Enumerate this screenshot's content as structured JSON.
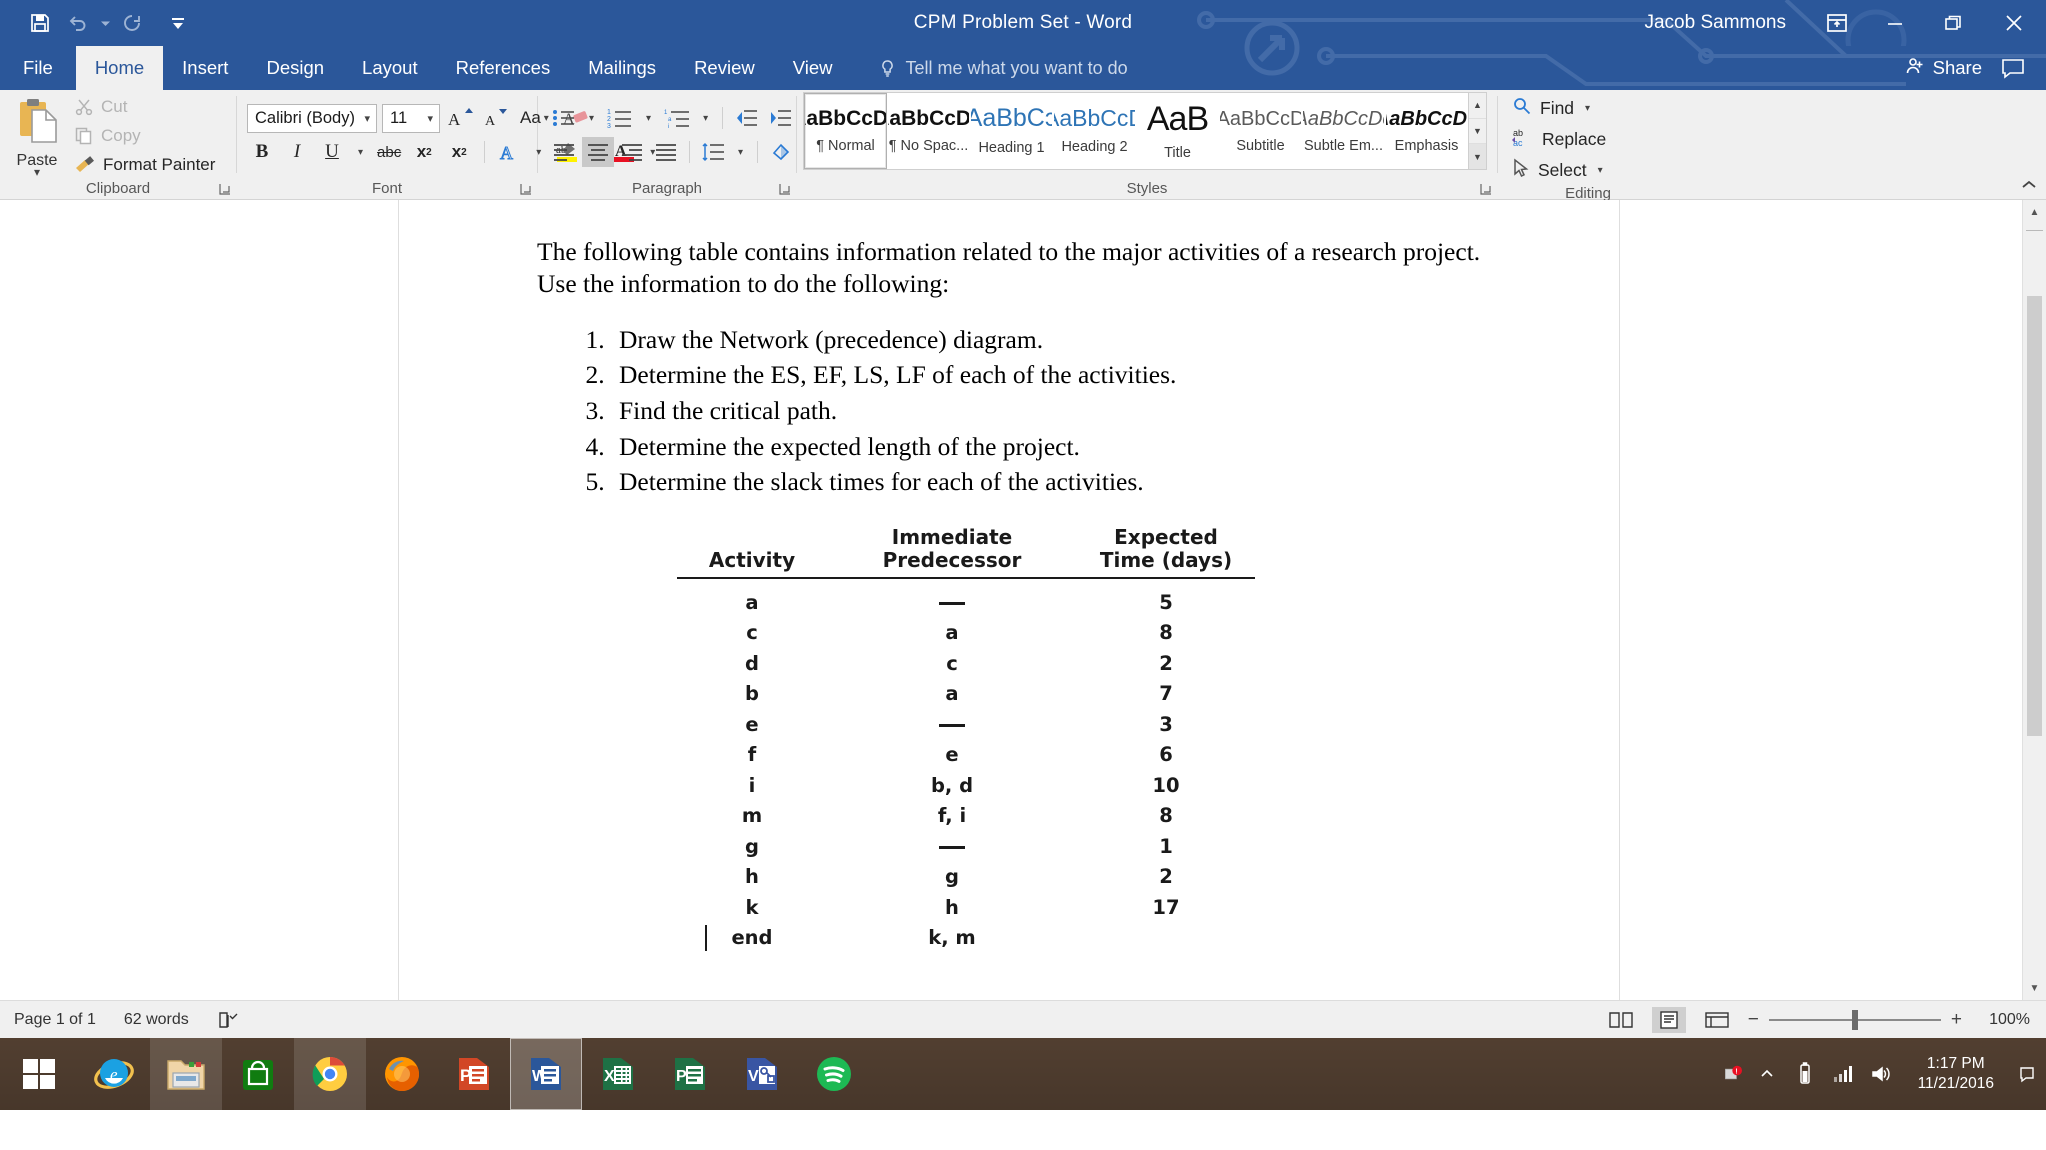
{
  "titlebar": {
    "document_title": "CPM Problem Set  -  Word",
    "user_name": "Jacob Sammons",
    "quick_access": [
      {
        "name": "save-icon",
        "label": "Save"
      },
      {
        "name": "undo-icon",
        "label": "Undo"
      },
      {
        "name": "redo-icon",
        "label": "Repeat"
      },
      {
        "name": "customize-quick-access-icon",
        "label": "Customize Quick Access Toolbar"
      }
    ],
    "window_controls": [
      {
        "name": "ribbon-display-options-icon",
        "label": "Ribbon Display Options"
      },
      {
        "name": "minimize-icon",
        "label": "Minimize"
      },
      {
        "name": "restore-icon",
        "label": "Restore Down"
      },
      {
        "name": "close-icon",
        "label": "Close"
      }
    ]
  },
  "tabs": [
    {
      "label": "File",
      "active": false
    },
    {
      "label": "Home",
      "active": true
    },
    {
      "label": "Insert",
      "active": false
    },
    {
      "label": "Design",
      "active": false
    },
    {
      "label": "Layout",
      "active": false
    },
    {
      "label": "References",
      "active": false
    },
    {
      "label": "Mailings",
      "active": false
    },
    {
      "label": "Review",
      "active": false
    },
    {
      "label": "View",
      "active": false
    }
  ],
  "tellme": {
    "text": "Tell me what you want to do"
  },
  "share": {
    "label": "Share"
  },
  "ribbon": {
    "clipboard": {
      "group_label": "Clipboard",
      "paste_label": "Paste",
      "cut_label": "Cut",
      "copy_label": "Copy",
      "format_painter_label": "Format Painter"
    },
    "font": {
      "group_label": "Font",
      "font_name": "Calibri (Body)",
      "font_size": "11",
      "bold_label": "B",
      "italic_label": "I",
      "underline_label": "U",
      "strikethrough_label": "abc",
      "subscript_label": "x",
      "superscript_label": "x",
      "change_case_label": "Aa"
    },
    "paragraph": {
      "group_label": "Paragraph"
    },
    "styles": {
      "group_label": "Styles",
      "items": [
        {
          "preview": "AaBbCcDc",
          "name": "¶ Normal",
          "cls": "sp-normal",
          "selected": true
        },
        {
          "preview": "AaBbCcDc",
          "name": "¶ No Spac...",
          "cls": "sp-normal",
          "selected": false
        },
        {
          "preview": "AaBbCɔ",
          "name": "Heading 1",
          "cls": "sp-h1",
          "selected": false
        },
        {
          "preview": "AaBbCcD",
          "name": "Heading 2",
          "cls": "sp-h2",
          "selected": false
        },
        {
          "preview": "AaB",
          "name": "Title",
          "cls": "sp-title",
          "selected": false
        },
        {
          "preview": "AaBbCcD",
          "name": "Subtitle",
          "cls": "sp-sub",
          "selected": false
        },
        {
          "preview": "AaBbCcDc",
          "name": "Subtle Em...",
          "cls": "sp-em",
          "selected": false
        },
        {
          "preview": "AaBbCcDc",
          "name": "Emphasis",
          "cls": "sp-emph",
          "selected": false
        }
      ]
    },
    "editing": {
      "group_label": "Editing",
      "find_label": "Find",
      "replace_label": "Replace",
      "select_label": "Select"
    }
  },
  "document": {
    "intro": "The following table contains information related to the major activities of a research project. Use the information to do the following:",
    "tasks": [
      "Draw the Network (precedence) diagram.",
      "Determine the ES, EF, LS, LF of each of the activities.",
      "Find the critical path.",
      "Determine the expected length of the project.",
      "Determine the slack times for each of the activities."
    ],
    "table": {
      "headers": [
        "Activity",
        "Immediate Predecessor",
        "Expected Time (days)"
      ],
      "header_lines": [
        [
          "",
          "Activity"
        ],
        [
          "Immediate",
          "Predecessor"
        ],
        [
          "Expected",
          "Time (days)"
        ]
      ],
      "rows": [
        {
          "activity": "a",
          "predecessor": "—",
          "time": "5"
        },
        {
          "activity": "c",
          "predecessor": "a",
          "time": "8"
        },
        {
          "activity": "d",
          "predecessor": "c",
          "time": "2"
        },
        {
          "activity": "b",
          "predecessor": "a",
          "time": "7"
        },
        {
          "activity": "e",
          "predecessor": "—",
          "time": "3"
        },
        {
          "activity": "f",
          "predecessor": "e",
          "time": "6"
        },
        {
          "activity": "i",
          "predecessor": "b, d",
          "time": "10"
        },
        {
          "activity": "m",
          "predecessor": "f, i",
          "time": "8"
        },
        {
          "activity": "g",
          "predecessor": "—",
          "time": "1"
        },
        {
          "activity": "h",
          "predecessor": "g",
          "time": "2"
        },
        {
          "activity": "k",
          "predecessor": "h",
          "time": "17"
        },
        {
          "activity": "end",
          "predecessor": "k, m",
          "time": ""
        }
      ]
    }
  },
  "statusbar": {
    "page": "Page 1 of 1",
    "words": "62 words",
    "proofing_icon": "proofing-errors-icon",
    "views": [
      {
        "name": "read-mode-icon",
        "label": "Read Mode",
        "active": false
      },
      {
        "name": "print-layout-icon",
        "label": "Print Layout",
        "active": true
      },
      {
        "name": "web-layout-icon",
        "label": "Web Layout",
        "active": false
      }
    ],
    "zoom_out": "−",
    "zoom_in": "+",
    "zoom_value": "100%"
  },
  "taskbar": {
    "start_label": "Start",
    "items": [
      {
        "name": "taskbar-internet-explorer",
        "label": "Internet Explorer",
        "state": "pinned"
      },
      {
        "name": "taskbar-file-explorer",
        "label": "File Explorer",
        "state": "running"
      },
      {
        "name": "taskbar-store",
        "label": "Store",
        "state": "pinned"
      },
      {
        "name": "taskbar-chrome",
        "label": "Google Chrome",
        "state": "running"
      },
      {
        "name": "taskbar-firefox",
        "label": "Mozilla Firefox",
        "state": "pinned"
      },
      {
        "name": "taskbar-powerpoint",
        "label": "PowerPoint",
        "state": "pinned"
      },
      {
        "name": "taskbar-word",
        "label": "Word",
        "state": "active"
      },
      {
        "name": "taskbar-excel",
        "label": "Excel",
        "state": "pinned"
      },
      {
        "name": "taskbar-publisher",
        "label": "Publisher",
        "state": "pinned"
      },
      {
        "name": "taskbar-visio",
        "label": "Visio",
        "state": "pinned"
      },
      {
        "name": "taskbar-spotify",
        "label": "Spotify",
        "state": "pinned"
      }
    ],
    "tray": {
      "show_hidden": "show-hidden-icons-icon",
      "action_center": "action-center-icon",
      "battery": "battery-icon",
      "network": "network-icon",
      "volume": "volume-icon",
      "time": "1:17 PM",
      "date": "11/21/2016"
    }
  },
  "colors": {
    "word_blue": "#2b579a",
    "ribbon_bg": "#f0f0f0",
    "accent_blue": "#2e74b5"
  }
}
